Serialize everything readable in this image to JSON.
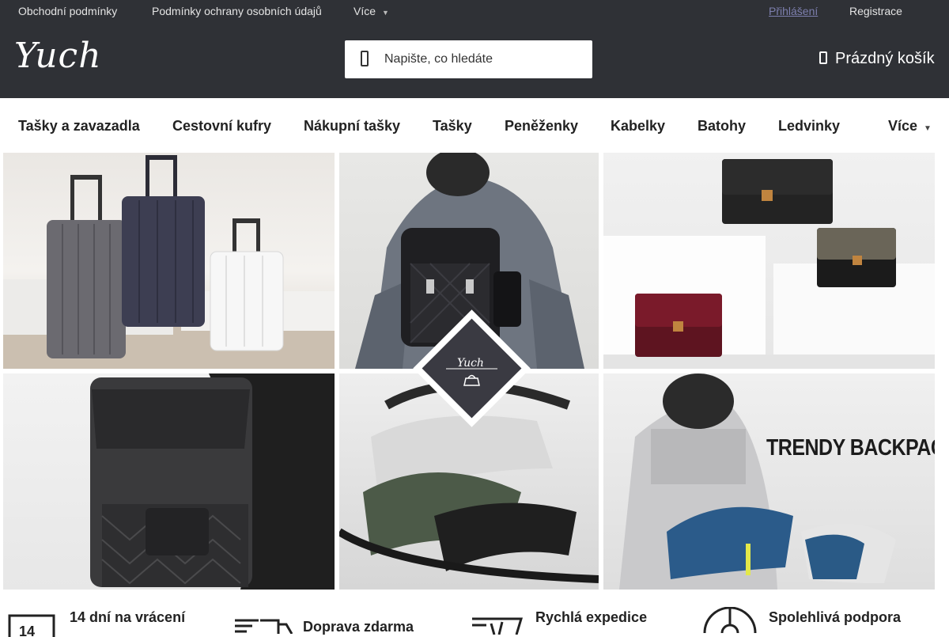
{
  "topbar": {
    "links": [
      "Obchodní podmínky",
      "Podmínky ochrany osobních údajů",
      "Více"
    ],
    "login": "Přihlášení",
    "register": "Registrace"
  },
  "header": {
    "logo": "Yuch",
    "search": {
      "placeholder": "Napište, co hledáte"
    },
    "cart": "Prázdný košík"
  },
  "nav": {
    "items": [
      "Tašky a zavazadla",
      "Cestovní kufry",
      "Nákupní tašky",
      "Tašky",
      "Peněženky",
      "Kabelky",
      "Batohy",
      "Ledvinky",
      "Více"
    ]
  },
  "banner": {
    "tile_text": "TRENDY BACKPACK",
    "badge_text": "Yuch"
  },
  "features": [
    "14 dní na vrácení",
    "Doprava zdarma",
    "Rychlá expedice",
    "Spolehlivá podpora"
  ],
  "features_icon_text": "14",
  "colors": {
    "header_bg": "#2f3136",
    "login_link": "#7d7fae",
    "text_dark": "#222222"
  }
}
